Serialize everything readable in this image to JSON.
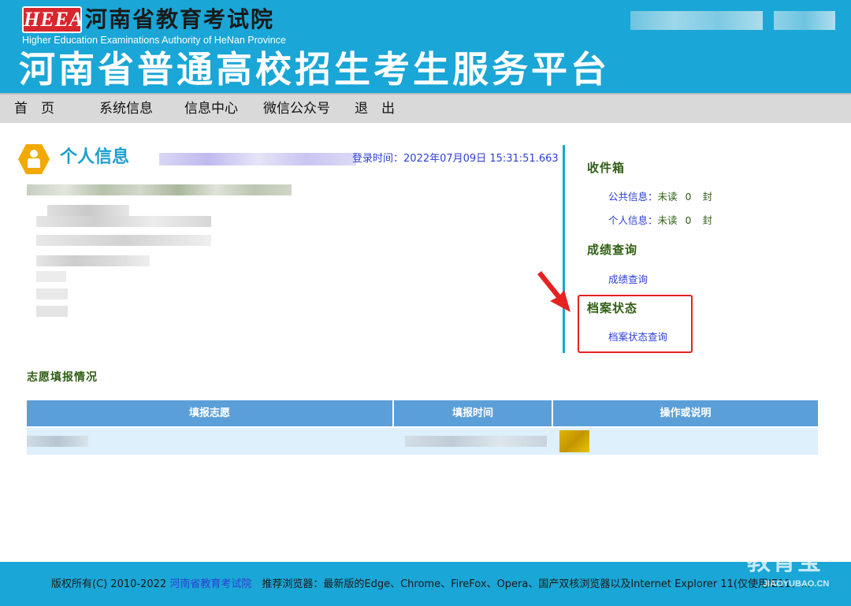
{
  "header": {
    "logo_text": "HEEA",
    "org_name": "河南省教育考试院",
    "org_name_en": "Higher Education Examinations Authority of HeNan Province",
    "platform_title": "河南省普通高校招生考生服务平台"
  },
  "nav": {
    "items": [
      {
        "label": "首　页"
      },
      {
        "label": "系统信息"
      },
      {
        "label": "信息中心"
      },
      {
        "label": "微信公众号"
      },
      {
        "label": "退　出"
      }
    ]
  },
  "personal": {
    "title": "个人信息",
    "login_label": "登录时间：",
    "login_time": "2022年07月09日 15:31:51.663"
  },
  "inbox": {
    "heading": "收件箱",
    "items": [
      {
        "label": "公共信息：",
        "status": "未读",
        "count": "0",
        "unit": "封"
      },
      {
        "label": "个人信息：",
        "status": "未读",
        "count": "0",
        "unit": "封"
      }
    ]
  },
  "scores": {
    "heading": "成绩查询",
    "link": "成绩查询"
  },
  "archive": {
    "heading": "档案状态",
    "link": "档案状态查询"
  },
  "volunteer": {
    "title": "志愿填报情况",
    "columns": [
      "填报志愿",
      "填报时间",
      "操作或说明"
    ]
  },
  "footer": {
    "copyright": "版权所有(C) 2010-2022 ",
    "org_link": "河南省教育考试院",
    "browser_note": "　推荐浏览器：最新版的Edge、Chrome、FireFox、Opera、国产双核浏览器以及Internet Explorer 11(仅使用IE11、..."
  },
  "watermark": {
    "text": "教育宝",
    "sub": "JIAOYUBAO.CN"
  },
  "colors": {
    "banner": "#1aa6d6",
    "nav": "#d9d9d9",
    "heading_green": "#2f5e14",
    "link_blue": "#2c3fd6",
    "table_header": "#5b9fd8",
    "highlight": "#e52222"
  }
}
